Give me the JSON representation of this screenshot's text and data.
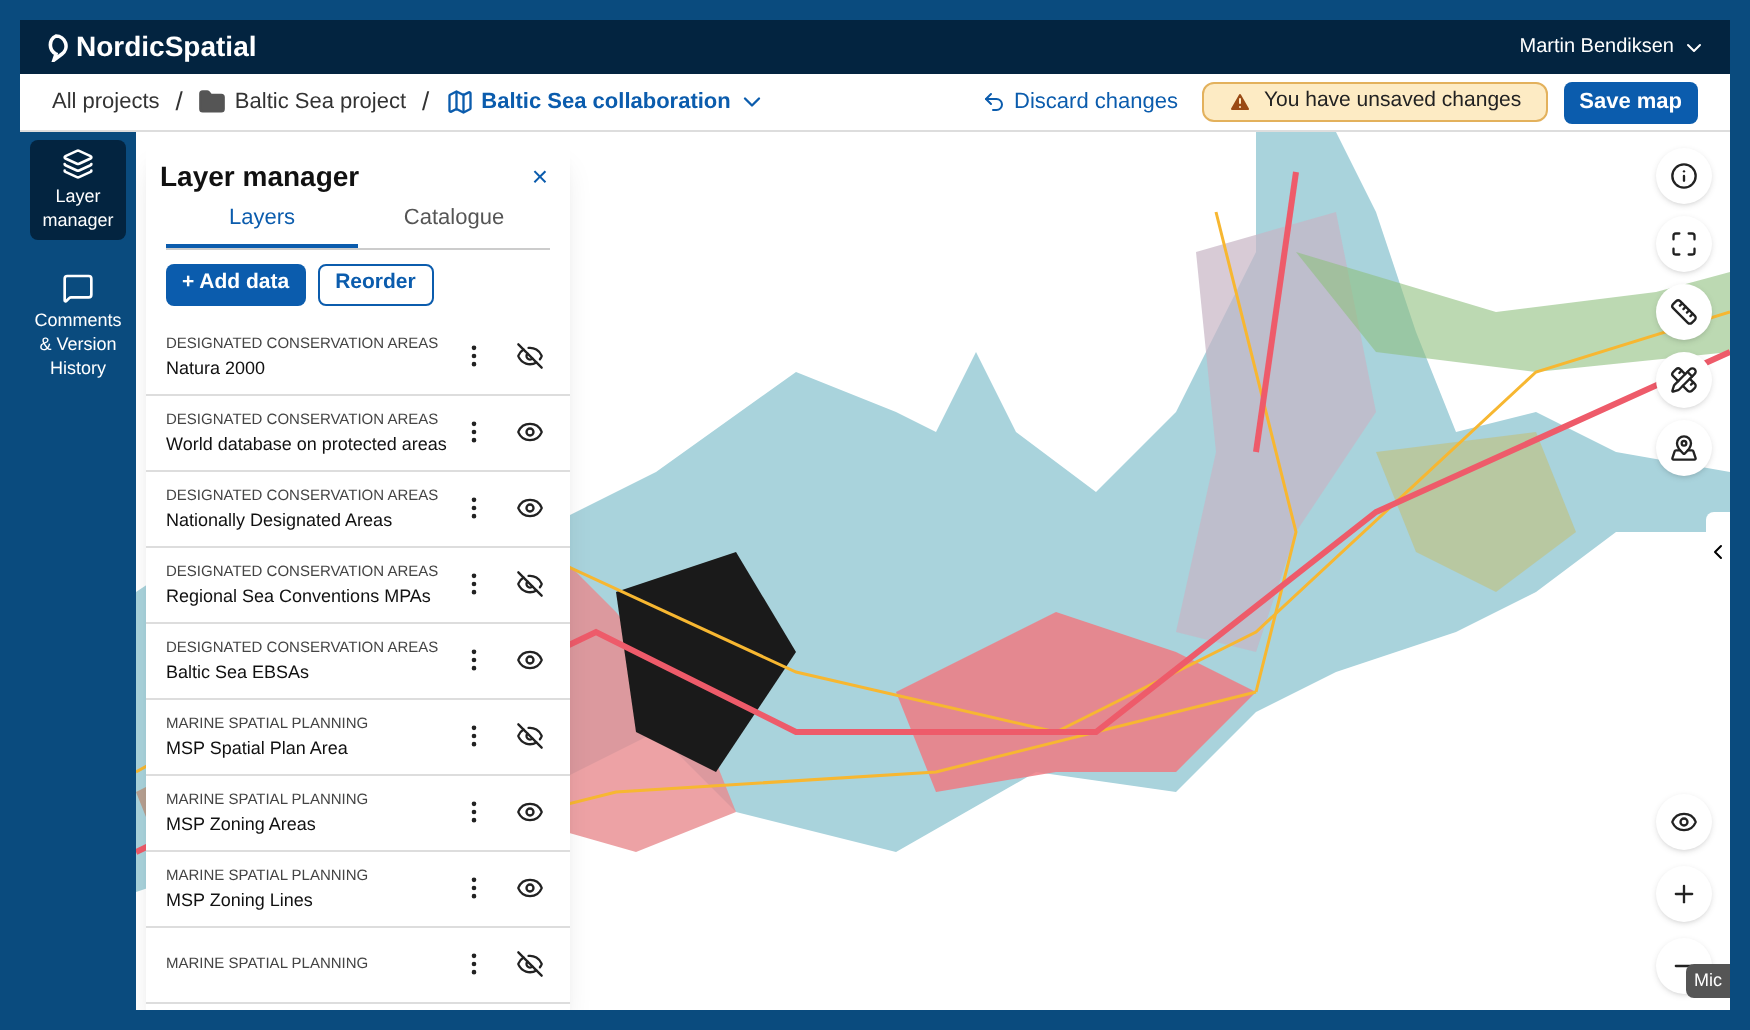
{
  "app": {
    "logo": "NordicSpatial",
    "user": "Martin Bendiksen"
  },
  "breadcrumbs": [
    {
      "label": "All projects",
      "kind": "text"
    },
    {
      "label": "Baltic Sea project",
      "kind": "folder",
      "separator": "/"
    },
    {
      "label": "Baltic Sea collaboration",
      "kind": "map",
      "separator": "/"
    }
  ],
  "toolbar": {
    "discard": "Discard changes",
    "warning": "You have unsaved changes",
    "save": "Save map"
  },
  "sidebar": {
    "items": [
      {
        "label": "Layer manager",
        "kind": "layers",
        "selected": true
      },
      {
        "label": "Comments & Version History",
        "kind": "comments",
        "selected": false
      }
    ]
  },
  "layer_manager": {
    "title": "Layer manager",
    "close": "×",
    "tabs": [
      {
        "label": "Layers",
        "selected": true
      },
      {
        "label": "Catalogue",
        "selected": false
      }
    ],
    "add_button": "+ Add data",
    "reorder_button": "Reorder",
    "layers": [
      {
        "category": "DESIGNATED CONSERVATION AREAS",
        "name": "Natura 2000",
        "visible": false
      },
      {
        "category": "DESIGNATED CONSERVATION AREAS",
        "name": "World database on protected areas",
        "visible": true
      },
      {
        "category": "DESIGNATED CONSERVATION AREAS",
        "name": "Nationally Designated Areas",
        "visible": true
      },
      {
        "category": "DESIGNATED CONSERVATION AREAS",
        "name": "Regional Sea Conventions MPAs",
        "visible": false
      },
      {
        "category": "DESIGNATED CONSERVATION AREAS",
        "name": "Baltic Sea EBSAs",
        "visible": true
      },
      {
        "category": "MARINE SPATIAL PLANNING",
        "name": "MSP Spatial Plan Area",
        "visible": false
      },
      {
        "category": "MARINE SPATIAL PLANNING",
        "name": "MSP Zoning Areas",
        "visible": true
      },
      {
        "category": "MARINE SPATIAL PLANNING",
        "name": "MSP Zoning Lines",
        "visible": true
      },
      {
        "category": "MARINE SPATIAL PLANNING",
        "visible": false
      }
    ]
  },
  "map_controls": {
    "attribution": "Mic"
  }
}
